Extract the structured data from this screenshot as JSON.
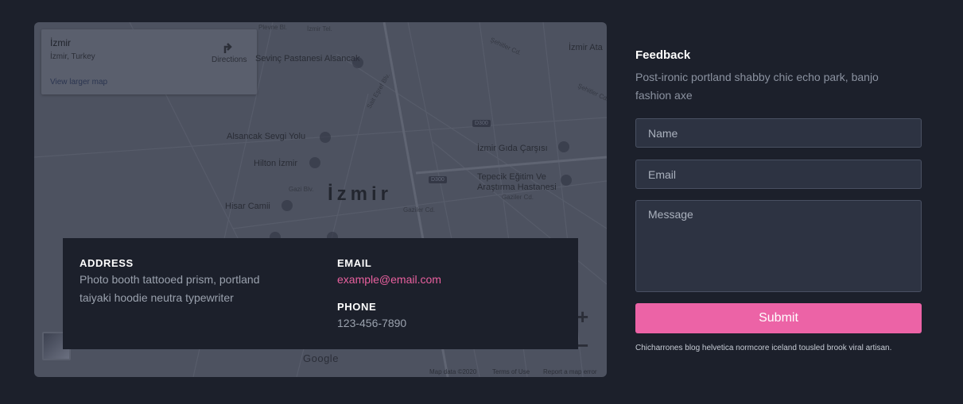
{
  "map": {
    "place_name": "İzmir",
    "place_region": "İzmir, Turkey",
    "directions_label": "Directions",
    "view_larger_label": "View larger map",
    "city_label": "İzmir",
    "poi_labels": [
      "Sevinç Pastanesi Alsancak",
      "Alsancak Sevgi Yolu",
      "Hilton İzmir",
      "Hisar Camii",
      "İzmir Gıda Çarşısı",
      "Tepecik Eğitim Ve Araştırma Hastanesi",
      "İzmir Ata"
    ],
    "street_labels": [
      "Plevne Bl.",
      "İzmir Tel.",
      "Şehitler Cd.",
      "Sait Eşref Blv.",
      "Gazi Blv.",
      "Gaziler Cd.",
      "Şehitler Cd.",
      "Gaziler Cd."
    ],
    "road_badges": [
      "D300",
      "D300"
    ],
    "zoom_in_label": "+",
    "zoom_out_label": "−",
    "google_label": "Google",
    "footer": {
      "map_data": "Map data ©2020",
      "terms": "Terms of Use",
      "report": "Report a map error"
    }
  },
  "contact": {
    "address_heading": "ADDRESS",
    "address_line1": "Photo booth tattooed prism, portland",
    "address_line2": "taiyaki hoodie neutra typewriter",
    "email_heading": "EMAIL",
    "email_value": "example@email.com",
    "phone_heading": "PHONE",
    "phone_value": "123-456-7890"
  },
  "feedback": {
    "title": "Feedback",
    "description": "Post-ironic portland shabby chic echo park, banjo fashion axe",
    "name_placeholder": "Name",
    "email_placeholder": "Email",
    "message_placeholder": "Message",
    "submit_label": "Submit",
    "note": "Chicharrones blog helvetica normcore iceland tousled brook viral artisan."
  },
  "colors": {
    "page_bg": "#1c202b",
    "accent": "#ec63a6",
    "email_link": "#e8609e",
    "input_bg": "#2d3342"
  }
}
